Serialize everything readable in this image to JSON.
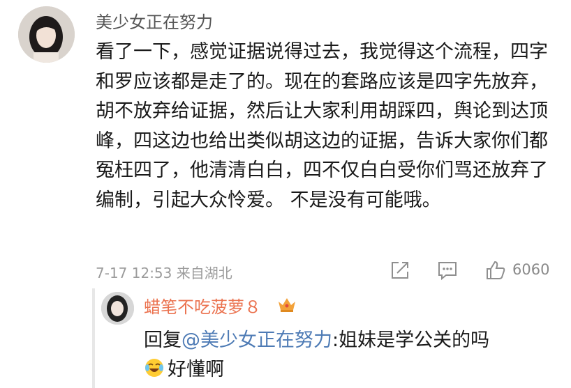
{
  "comment": {
    "username": "美少女正在努力",
    "text": "看了一下，感觉证据说得过去，我觉得这个流程，四字和罗应该都是走了的。现在的套路应该是四字先放弃，胡不放弃给证据，然后让大家利用胡踩四，舆论到达顶峰，四这边也给出类似胡这边的证据，告诉大家你们都冤枉四了，他清清白白，四不仅白白受你们骂还放弃了编制，引起大众怜爱。 不是没有可能哦。",
    "timestamp": "7-17 12:53",
    "location": "来自湖北",
    "like_count": "6060",
    "icons": [
      "share-icon",
      "comment-icon",
      "like-icon"
    ]
  },
  "reply": {
    "username": "蜡笔不吃菠萝８",
    "badge": "crown-badge-icon",
    "prefix": "回复",
    "mention": "@美少女正在努力",
    "text": ":姐妹是学公关的吗",
    "emoji": "laugh-cry-emoji-icon",
    "text2": "好懂啊"
  },
  "colors": {
    "username": "#555555",
    "reply_username": "#eb7350",
    "mention": "#4e7bb5",
    "meta": "#9b9b9b",
    "crown": "#f3a23a"
  }
}
